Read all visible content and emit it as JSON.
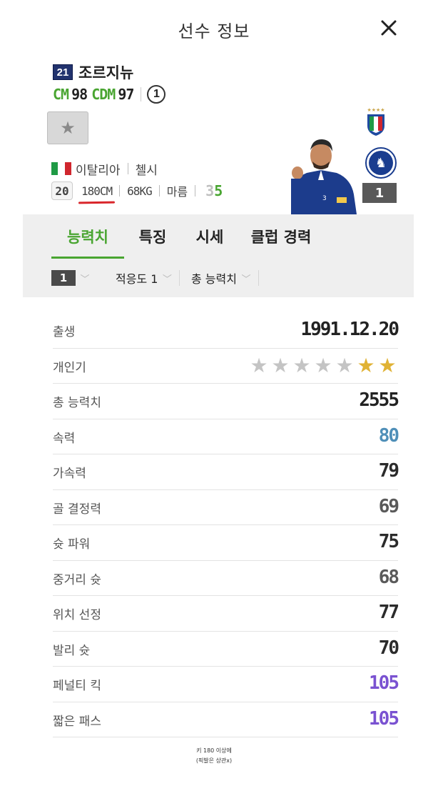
{
  "header": {
    "title": "선수 정보",
    "close_icon": "close-icon"
  },
  "player": {
    "season_badge": "21",
    "name": "조르지뉴",
    "positions": [
      {
        "name": "CM",
        "value": "98"
      },
      {
        "name": "CDM",
        "value": "97"
      }
    ],
    "rank": "1",
    "favorite_icon": "star-icon",
    "nation": "이탈리아",
    "club": "첼시",
    "age": "20",
    "height": "180CM",
    "weight": "68KG",
    "body_type": "마름",
    "foot_left": "3",
    "foot_right": "5",
    "enhancement": "1",
    "nation_emblem": "italy-crest-icon",
    "club_emblem": "chelsea-crest-icon"
  },
  "tabs": [
    {
      "label": "능력치",
      "active": true
    },
    {
      "label": "특징",
      "active": false
    },
    {
      "label": "시세",
      "active": false
    },
    {
      "label": "클럽 경력",
      "active": false
    }
  ],
  "filters": {
    "enhancement": "1",
    "adaptation": "적응도 1",
    "total_stat": "총 능력치"
  },
  "stats": [
    {
      "label": "출생",
      "value": "1991.12.20",
      "color": "#222222"
    },
    {
      "label": "개인기",
      "stars_total": 7,
      "stars_filled": 2
    },
    {
      "label": "총 능력치",
      "value": "2555",
      "color": "#222222"
    },
    {
      "label": "속력",
      "value": "80",
      "color": "#4f8fb8"
    },
    {
      "label": "가속력",
      "value": "79",
      "color": "#2b2b2b"
    },
    {
      "label": "골 결정력",
      "value": "69",
      "color": "#5a5a5a"
    },
    {
      "label": "슛 파워",
      "value": "75",
      "color": "#2b2b2b"
    },
    {
      "label": "중거리 슛",
      "value": "68",
      "color": "#5a5a5a"
    },
    {
      "label": "위치 선정",
      "value": "77",
      "color": "#2b2b2b"
    },
    {
      "label": "발리 슛",
      "value": "70",
      "color": "#2b2b2b"
    },
    {
      "label": "페널티 킥",
      "value": "105",
      "color": "#7a52d1"
    },
    {
      "label": "짧은 패스",
      "value": "105",
      "color": "#7a52d1"
    }
  ],
  "footer": {
    "line1": "키 180 이상에",
    "line2": "(픽발은 상관x)"
  },
  "colors": {
    "accent": "#49a531",
    "star_filled": "#e0b234",
    "star_empty": "#c4c4c4"
  }
}
